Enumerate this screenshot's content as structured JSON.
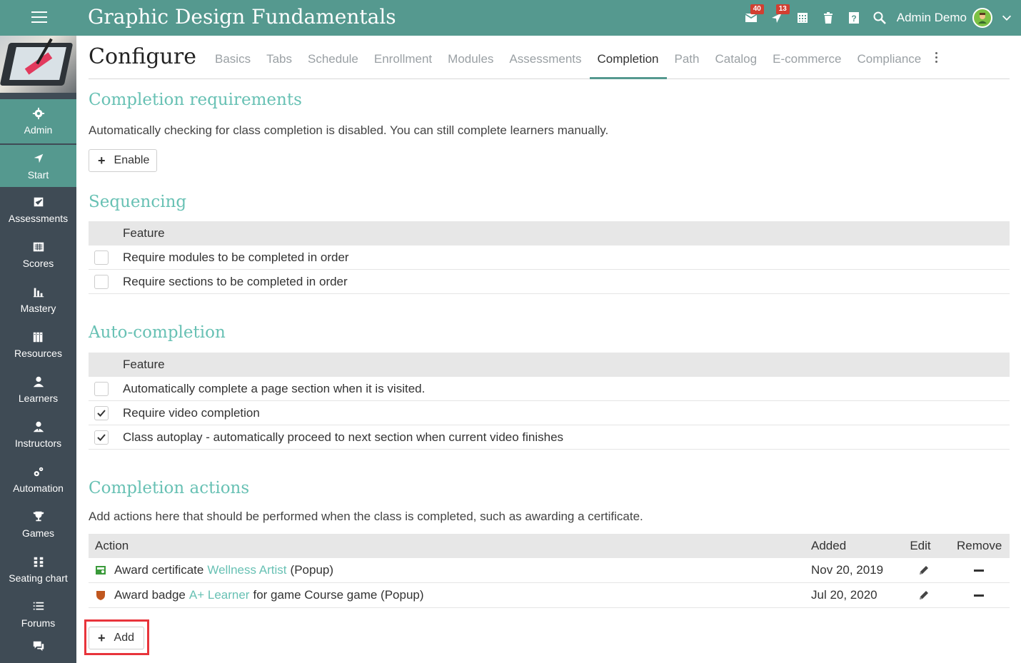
{
  "header": {
    "app_title": "Graphic Design Fundamentals",
    "mail_badge": "40",
    "notif_badge": "13",
    "user_name": "Admin Demo"
  },
  "sidebar": {
    "items": [
      {
        "label": "Admin",
        "icon": "gear-icon"
      },
      {
        "label": "Start",
        "icon": "location-arrow-icon"
      },
      {
        "label": "Assessments",
        "icon": "check-square-icon"
      },
      {
        "label": "Scores",
        "icon": "table-icon"
      },
      {
        "label": "Mastery",
        "icon": "bar-chart-icon"
      },
      {
        "label": "Resources",
        "icon": "books-icon"
      },
      {
        "label": "Learners",
        "icon": "user-icon"
      },
      {
        "label": "Instructors",
        "icon": "instructor-icon"
      },
      {
        "label": "Automation",
        "icon": "gears-icon"
      },
      {
        "label": "Games",
        "icon": "trophy-icon"
      },
      {
        "label": "Seating chart",
        "icon": "grid-icon"
      },
      {
        "label": "Forums",
        "icon": "list-icon"
      }
    ]
  },
  "page": {
    "title": "Configure",
    "tabs": [
      "Basics",
      "Tabs",
      "Schedule",
      "Enrollment",
      "Modules",
      "Assessments",
      "Completion",
      "Path",
      "Catalog",
      "E-commerce",
      "Compliance"
    ],
    "active_tab": "Completion"
  },
  "completion_requirements": {
    "title": "Completion requirements",
    "description": "Automatically checking for class completion is disabled. You can still complete learners manually.",
    "enable_label": "Enable"
  },
  "sequencing": {
    "title": "Sequencing",
    "header": "Feature",
    "rows": [
      {
        "label": "Require modules to be completed in order",
        "checked": false
      },
      {
        "label": "Require sections to be completed in order",
        "checked": false
      }
    ]
  },
  "auto_completion": {
    "title": "Auto-completion",
    "header": "Feature",
    "rows": [
      {
        "label": "Automatically complete a page section when it is visited.",
        "checked": false
      },
      {
        "label": "Require video completion",
        "checked": true
      },
      {
        "label": "Class autoplay - automatically proceed to next section when current video finishes",
        "checked": true
      }
    ]
  },
  "completion_actions": {
    "title": "Completion actions",
    "description": "Add actions here that should be performed when the class is completed, such as awarding a certificate.",
    "headers": {
      "action": "Action",
      "added": "Added",
      "edit": "Edit",
      "remove": "Remove"
    },
    "rows": [
      {
        "prefix": "Award certificate",
        "link": "Wellness Artist",
        "suffix": "(Popup)",
        "added": "Nov 20, 2019",
        "icon": "certificate-icon",
        "icon_color": "#3a9a3a"
      },
      {
        "prefix": "Award badge",
        "link": "A+ Learner",
        "suffix": "for game Course game (Popup)",
        "added": "Jul 20, 2020",
        "icon": "badge-shield-icon",
        "icon_color": "#c0571f"
      }
    ],
    "add_label": "Add"
  },
  "colors": {
    "accent": "#55998f",
    "section_title": "#68c1b4",
    "sidebar_bg": "#3f4b55",
    "highlight": "#e8343b"
  }
}
